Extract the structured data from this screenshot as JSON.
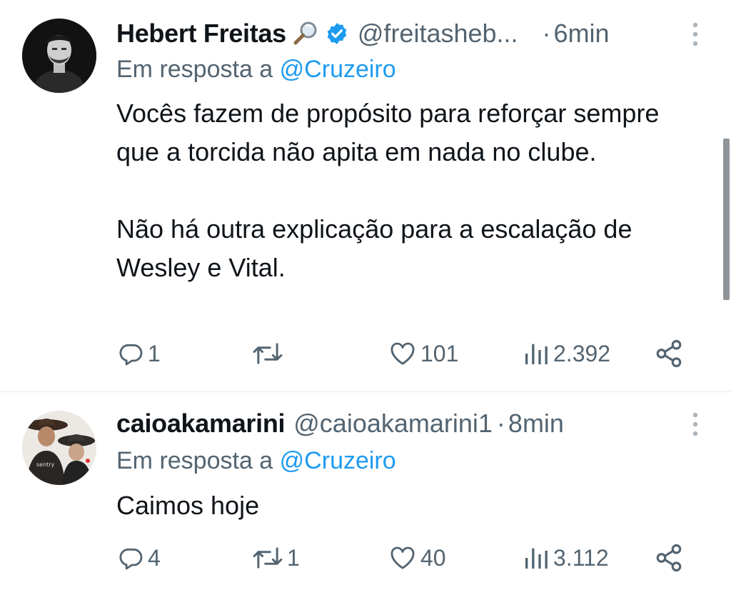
{
  "tweets": [
    {
      "display_name": "Hebert Freitas",
      "name_emoji": "magnifying-glass",
      "verified": true,
      "handle": "@freitasheb...",
      "dot": "·",
      "time": "6min",
      "reply_prefix": "Em resposta a",
      "reply_mention": "@Cruzeiro",
      "paragraphs": [
        "Vocês fazem de propósito para reforçar sempre que a torcida não apita em nada no clube.",
        "Não há outra explicação para a escalação de Wesley e Vital."
      ],
      "replies": "1",
      "retweets": "",
      "likes": "101",
      "views": "2.392"
    },
    {
      "display_name": "caioakamarini",
      "verified": false,
      "handle": "@caioakamarini1",
      "dot": "·",
      "time": "8min",
      "reply_prefix": "Em resposta a",
      "reply_mention": "@Cruzeiro",
      "paragraphs": [
        "Caimos hoje"
      ],
      "replies": "4",
      "retweets": "1",
      "likes": "40",
      "views": "3.112"
    }
  ],
  "colors": {
    "text": "#0f1419",
    "secondary": "#536471",
    "link": "#1d9bf0",
    "verified": "#1d9bf0",
    "divider": "#e6e9ec"
  },
  "icons": [
    "reply-icon",
    "retweet-icon",
    "like-icon",
    "views-icon",
    "share-icon",
    "more-icon",
    "verified-icon"
  ]
}
